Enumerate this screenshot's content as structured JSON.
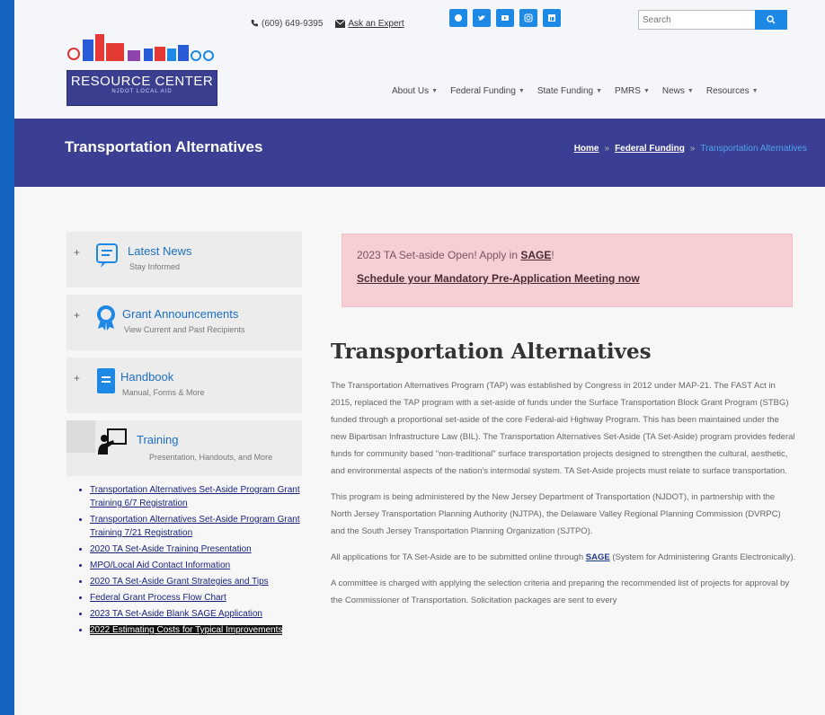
{
  "header": {
    "logo_title": "RESOURCE CENTER",
    "logo_subtitle": "NJDOT LOCAL AID",
    "phone": "(609) 649-9395",
    "ask_expert": "Ask an Expert",
    "search_placeholder": "Search",
    "social_icons": [
      "facebook-icon",
      "twitter-icon",
      "youtube-icon",
      "instagram-icon",
      "linkedin-icon"
    ],
    "brand_color": "#1e88e5"
  },
  "nav": {
    "items": [
      "About Us",
      "Federal Funding",
      "State Funding",
      "PMRS",
      "News",
      "Resources"
    ]
  },
  "banner": {
    "title": "Transportation Alternatives",
    "breadcrumb": {
      "home": "Home",
      "sep": "»",
      "section": "Federal Funding",
      "current": "Transportation Alternatives"
    },
    "color": "#3b3f93"
  },
  "sidebar": {
    "cards": [
      {
        "title": "Latest News",
        "subtitle": "Stay Informed",
        "icon": "news-icon"
      },
      {
        "title": "Grant Announcements",
        "subtitle": "View Current and Past Recipients",
        "icon": "award-icon"
      },
      {
        "title": "Handbook",
        "subtitle": "Manual, Forms & More",
        "icon": "book-icon"
      },
      {
        "title": "Training",
        "subtitle": "Presentation, Handouts, and More",
        "icon": "presentation-icon"
      }
    ],
    "links": [
      "Transportation Alternatives Set-Aside Program Grant Training 6/7 Registration",
      "Transportation Alternatives Set-Aside Program Grant Training 7/21 Registration",
      "2020 TA Set-Aside Training Presentation",
      "MPO/Local Aid Contact Information",
      "2020 TA Set-Aside Grant Strategies and Tips",
      "Federal Grant Process Flow Chart",
      "2023 TA Set-Aside Blank SAGE Application",
      "2022 Estimating Costs for Typical Improvements"
    ]
  },
  "alert": {
    "line1_prefix": "2023 TA Set-aside Open! Apply in",
    "line1_link": "SAGE",
    "line1_suffix": "!",
    "line2": "Schedule your Mandatory Pre-Application Meeting now"
  },
  "main": {
    "heading": "Transportation Alternatives",
    "p1": "The Transportation Alternatives Program (TAP) was established by Congress in 2012 under MAP-21. The FAST Act in 2015, replaced the TAP program with a set-aside of funds under the Surface Transportation Block Grant Program (STBG) funded through a proportional set-aside of the core Federal-aid Highway Program. This has been maintained under the new Bipartisan Infrastructure Law (BIL). The Transportation Alternatives Set-Aside (TA Set-Aside) program provides federal funds for community based \"non-traditional\" surface transportation projects designed to strengthen the cultural, aesthetic, and environmental aspects of the nation's intermodal system. TA Set-Aside projects must relate to surface transportation.",
    "p2": "This program is being administered by the New Jersey Department of Transportation (NJDOT), in partnership with the North Jersey Transportation Planning Authority (NJTPA), the Delaware Valley Regional Planning Commission (DVRPC) and the South Jersey Transportation Planning Organization (SJTPO).",
    "p3_prefix": "All applications for TA Set-Aside are to be submitted online through",
    "p3_link": "SAGE",
    "p3_suffix": "(System for Administering Grants Electronically).",
    "p4": "A committee is charged with applying the selection criteria and preparing the recommended list of projects for approval by the Commissioner of Transportation. Solicitation packages are sent to every"
  }
}
